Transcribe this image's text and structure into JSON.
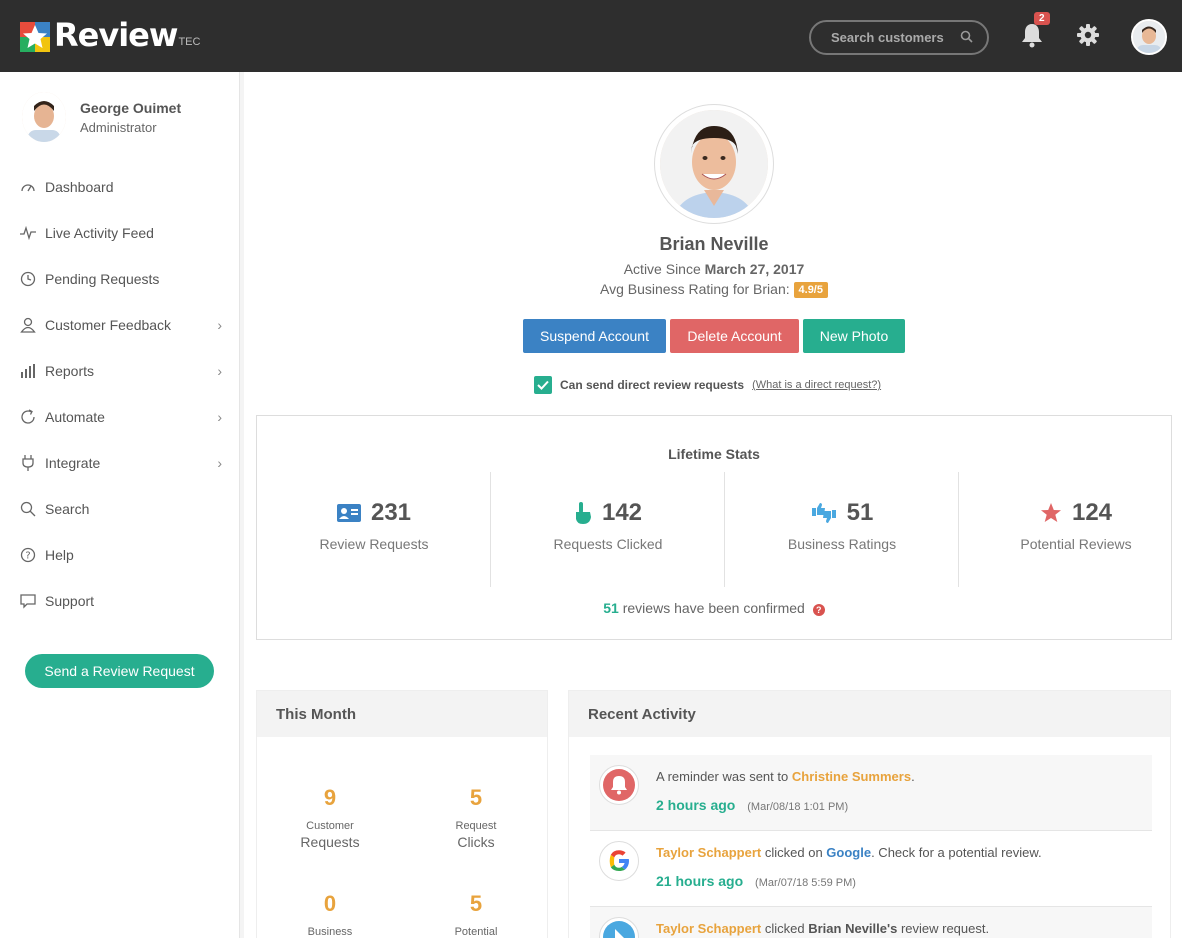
{
  "app": {
    "logo_text": "Review",
    "logo_sub": "TEC"
  },
  "header": {
    "search_placeholder": "Search customers",
    "notification_count": "2"
  },
  "user": {
    "name": "George Ouimet",
    "role": "Administrator"
  },
  "sidebar": {
    "items": [
      {
        "label": "Dashboard",
        "icon": "dashboard-icon",
        "has_children": false
      },
      {
        "label": "Live Activity Feed",
        "icon": "pulse-icon",
        "has_children": false
      },
      {
        "label": "Pending Requests",
        "icon": "clock-icon",
        "has_children": false
      },
      {
        "label": "Customer Feedback",
        "icon": "person-icon",
        "has_children": true
      },
      {
        "label": "Reports",
        "icon": "bar-chart-icon",
        "has_children": true
      },
      {
        "label": "Automate",
        "icon": "refresh-icon",
        "has_children": true
      },
      {
        "label": "Integrate",
        "icon": "plug-icon",
        "has_children": true
      },
      {
        "label": "Search",
        "icon": "search-icon",
        "has_children": false
      },
      {
        "label": "Help",
        "icon": "question-icon",
        "has_children": false
      },
      {
        "label": "Support",
        "icon": "chat-icon",
        "has_children": false
      }
    ],
    "cta_label": "Send a Review Request"
  },
  "profile": {
    "name": "Brian Neville",
    "active_since_label": "Active Since",
    "active_since_date": "March 27, 2017",
    "rating_label": "Avg Business Rating for Brian:",
    "rating_value": "4.9/5",
    "buttons": {
      "suspend": "Suspend Account",
      "delete": "Delete Account",
      "new_photo": "New Photo"
    },
    "direct_requests_label": "Can send direct review requests",
    "direct_requests_checked": true,
    "direct_requests_help": "(What is a direct request?)"
  },
  "lifetime_stats": {
    "title": "Lifetime Stats",
    "items": [
      {
        "value": "231",
        "label": "Review Requests",
        "icon": "id-card-icon",
        "color": "#3b82c4"
      },
      {
        "value": "142",
        "label": "Requests Clicked",
        "icon": "pointer-hand-icon",
        "color": "#27ae8f"
      },
      {
        "value": "51",
        "label": "Business Ratings",
        "icon": "thumbs-icon",
        "color": "#4aa8e0"
      },
      {
        "value": "124",
        "label": "Potential Reviews",
        "icon": "star-icon",
        "color": "#e06666"
      }
    ],
    "confirmed_count": "51",
    "confirmed_text": "reviews have been confirmed"
  },
  "this_month": {
    "title": "This Month",
    "items": [
      {
        "value": "9",
        "small": "Customer",
        "big": "Requests"
      },
      {
        "value": "5",
        "small": "Request",
        "big": "Clicks"
      },
      {
        "value": "0",
        "small": "Business",
        "big": ""
      },
      {
        "value": "5",
        "small": "Potential",
        "big": ""
      }
    ]
  },
  "recent_activity": {
    "title": "Recent Activity",
    "items": [
      {
        "icon": "bell-icon",
        "prefix": "A reminder was sent to",
        "name": "Christine Summers",
        "suffix": ".",
        "relative": "2 hours ago",
        "absolute": "(Mar/08/18 1:01 PM)"
      },
      {
        "icon": "google-icon",
        "name": "Taylor Schappert",
        "middle": "clicked on",
        "link": "Google",
        "suffix": ". Check for a potential review.",
        "relative": "21 hours ago",
        "absolute": "(Mar/07/18 5:59 PM)"
      },
      {
        "icon": "cursor-click-icon",
        "name": "Taylor Schappert",
        "middle": "clicked",
        "target": "Brian Neville's",
        "suffix": "review request."
      }
    ]
  }
}
